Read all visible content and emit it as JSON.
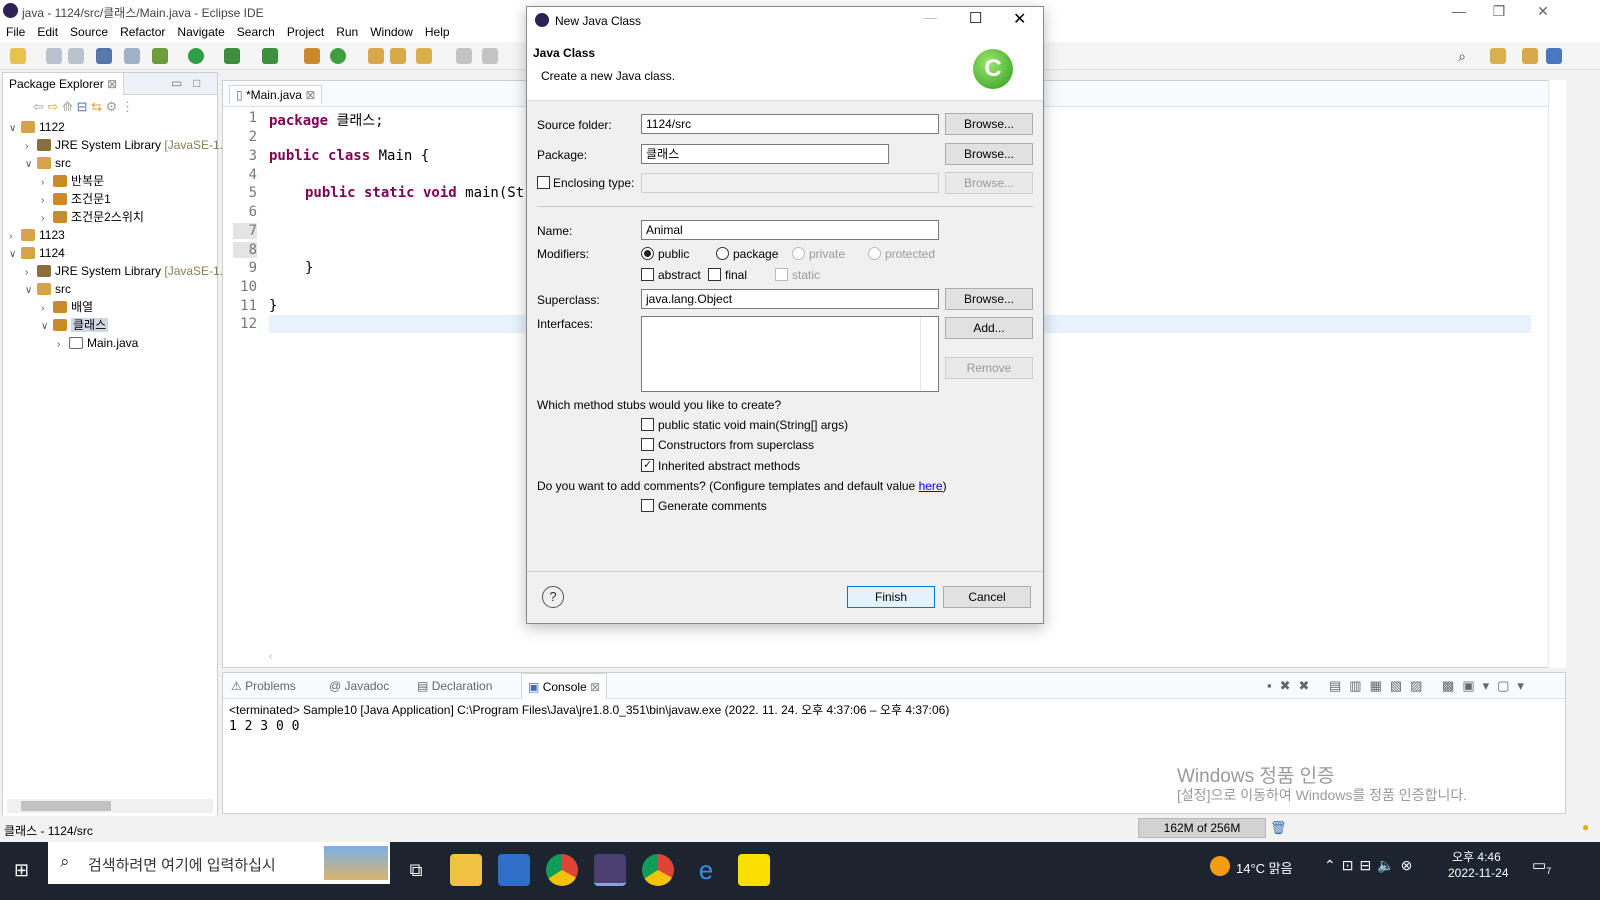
{
  "window": {
    "title": "java - 1124/src/클래스/Main.java - Eclipse IDE"
  },
  "menu": [
    "File",
    "Edit",
    "Source",
    "Refactor",
    "Navigate",
    "Search",
    "Project",
    "Run",
    "Window",
    "Help"
  ],
  "package_explorer": {
    "tab": "Package Explorer",
    "items": [
      {
        "label": "1122",
        "extra": ""
      },
      {
        "label": "JRE System Library",
        "extra": "[JavaSE-1."
      },
      {
        "label": "src",
        "extra": ""
      },
      {
        "label": "반복문",
        "extra": ""
      },
      {
        "label": "조건문1",
        "extra": ""
      },
      {
        "label": "조건문2스위치",
        "extra": ""
      },
      {
        "label": "1123",
        "extra": ""
      },
      {
        "label": "1124",
        "extra": ""
      },
      {
        "label": "JRE System Library",
        "extra": "[JavaSE-1."
      },
      {
        "label": "src",
        "extra": ""
      },
      {
        "label": "배열",
        "extra": ""
      },
      {
        "label": "클래스",
        "extra": ""
      },
      {
        "label": "Main.java",
        "extra": ""
      }
    ]
  },
  "editor": {
    "tab": "*Main.java",
    "lines": [
      "1",
      "2",
      "3",
      "4",
      "5",
      "6",
      "7",
      "8",
      "9",
      "10",
      "11",
      "12"
    ],
    "code": {
      "l1_kw": "package",
      "l1_rest": " 클래스;",
      "l3_kw": "public class",
      "l3_rest": " Main {",
      "l5_kw": "public static void",
      "l5_rest": " main(St",
      "l9": "}",
      "l11": "}"
    }
  },
  "console": {
    "tabs": [
      "Problems",
      "Javadoc",
      "Declaration",
      "Console"
    ],
    "header": "<terminated> Sample10 [Java Application] C:\\Program Files\\Java\\jre1.8.0_351\\bin\\javaw.exe  (2022. 11. 24. 오후 4:37:06 – 오후 4:37:06)",
    "output": "1 2 3 0 0"
  },
  "watermark": {
    "line1": "Windows 정품 인증",
    "line2": "[설정]으로 이동하여 Windows를 정품 인증합니다."
  },
  "status": {
    "left": "클래스 - 1124/src",
    "memory": "162M of 256M"
  },
  "dialog": {
    "title": "New Java Class",
    "heading": "Java Class",
    "subheading": "Create a new Java class.",
    "source_folder_label": "Source folder:",
    "source_folder_value": "1124/src",
    "package_label": "Package:",
    "package_value": "클래스",
    "enclosing_label": "Enclosing type:",
    "browse": "Browse...",
    "name_label": "Name:",
    "name_value": "Animal",
    "modifiers_label": "Modifiers:",
    "mod_public": "public",
    "mod_package": "package",
    "mod_private": "private",
    "mod_protected": "protected",
    "mod_abstract": "abstract",
    "mod_final": "final",
    "mod_static": "static",
    "superclass_label": "Superclass:",
    "superclass_value": "java.lang.Object",
    "interfaces_label": "Interfaces:",
    "add": "Add...",
    "remove": "Remove",
    "stubs_question": "Which method stubs would you like to create?",
    "stub_main": "public static void main(String[] args)",
    "stub_ctor": "Constructors from superclass",
    "stub_inherited": "Inherited abstract methods",
    "comments_question": "Do you want to add comments? (Configure templates and default value ",
    "comments_link": "here",
    "comments_close": ")",
    "generate_comments": "Generate comments",
    "finish": "Finish",
    "cancel": "Cancel",
    "help": "?"
  },
  "taskbar": {
    "search": "검색하려면 여기에 입력하십시",
    "weather": "14°C 맑음",
    "time": "오후 4:46",
    "date": "2022-11-24",
    "notif": "7"
  },
  "colors": {
    "accent": "#3c6fb0",
    "keyword": "#7f0055",
    "taskbar": "#1c2430",
    "link": "#0000ee"
  }
}
